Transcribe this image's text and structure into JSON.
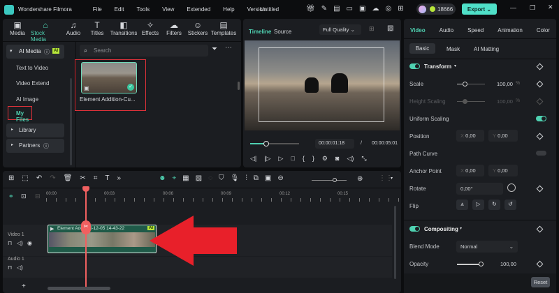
{
  "app": {
    "name": "Wondershare Filmora",
    "doc_title": "Untitled",
    "credits": "18666",
    "export_label": "Export",
    "menu": [
      "File",
      "Edit",
      "Tools",
      "View",
      "Extended",
      "Help",
      "Version"
    ]
  },
  "tools": [
    {
      "label": "Media",
      "icon": "▣"
    },
    {
      "label": "Stock Media",
      "icon": "⌂"
    },
    {
      "label": "Audio",
      "icon": "♫"
    },
    {
      "label": "Titles",
      "icon": "T"
    },
    {
      "label": "Transitions",
      "icon": "◧"
    },
    {
      "label": "Effects",
      "icon": "✧"
    },
    {
      "label": "Filters",
      "icon": "☁"
    },
    {
      "label": "Stickers",
      "icon": "☺"
    },
    {
      "label": "Templates",
      "icon": "▤"
    }
  ],
  "sidebar": {
    "ai_media": "AI Media",
    "ai_badge": "AI",
    "items": [
      "Text to Video",
      "Video Extend",
      "AI Image",
      "My Files"
    ],
    "library": "Library",
    "partners": "Partners"
  },
  "search": {
    "placeholder": "Search"
  },
  "media": {
    "name": "Element Addition-Cu..."
  },
  "preview": {
    "tab_timeline": "Timeline",
    "tab_source": "Source",
    "quality": "Full Quality",
    "current_time": "00:00:01:18",
    "separator": "/",
    "total_time": "00:00:05:01",
    "progress": 0.3
  },
  "props": {
    "tabs": [
      "Video",
      "Audio",
      "Speed",
      "Animation",
      "Color"
    ],
    "subtabs": [
      "Basic",
      "Mask",
      "AI Matting"
    ],
    "transform": "Transform",
    "scale_label": "Scale",
    "scale_value": "100,00",
    "pct": "%",
    "height_label": "Height Scaling",
    "height_value": "100,00",
    "uniform_label": "Uniform Scaling",
    "position_label": "Position",
    "x": "X",
    "y": "Y",
    "pos_x": "0,00",
    "pos_y": "0,00",
    "path_label": "Path Curve",
    "anchor_label": "Anchor Point",
    "anchor_x": "0,00",
    "anchor_y": "0,00",
    "rotate_label": "Rotate",
    "rotate_value": "0,00°",
    "flip_label": "Flip",
    "compositing": "Compositing",
    "blend_label": "Blend Mode",
    "blend_value": "Normal",
    "opacity_label": "Opacity",
    "opacity_value": "100,00",
    "reset": "Reset"
  },
  "timeline": {
    "ticks": [
      "00:00",
      "00:03",
      "00:06",
      "00:09",
      "00:12",
      "00:15"
    ],
    "video_track": "Video 1",
    "audio_track": "Audio 1",
    "clip_name": "Element Add...25-12-05 14-43-22",
    "clip_badge": "AI"
  },
  "colors": {
    "accent": "#4fd1b1",
    "highlight": "#e0323a",
    "arrow": "#e8202a"
  }
}
